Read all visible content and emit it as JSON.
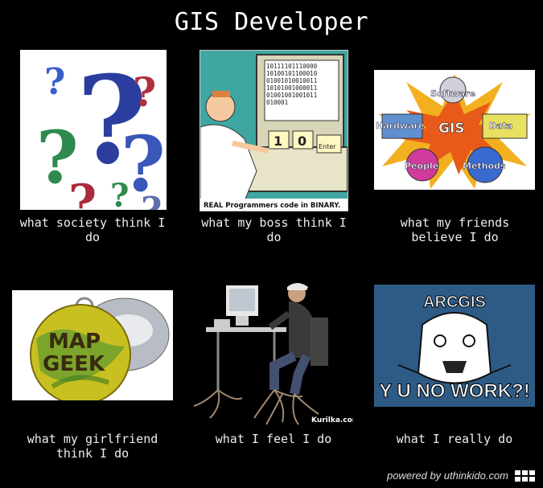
{
  "title": "GIS Developer",
  "panels": [
    {
      "caption": "what society think I do",
      "image": "question-marks"
    },
    {
      "caption": "what my boss think I do",
      "image": "binary-programmer-cartoon",
      "image_text": {
        "binary_lines": [
          "10111101110000",
          "10100101100010",
          "01001010010011",
          "10101001000011",
          "01001001001011",
          "010001"
        ],
        "keys": [
          "1",
          "0",
          "Enter"
        ],
        "footer": "REAL Programmers code in BINARY."
      }
    },
    {
      "caption": "what my friends believe I do",
      "image": "gis-diagram",
      "image_text": {
        "center": "GIS",
        "nodes": [
          "Software",
          "Hardware",
          "Data",
          "People",
          "Methods"
        ]
      }
    },
    {
      "caption": "what my girlfriend think I do",
      "image": "map-geek-button",
      "image_text": {
        "badge": [
          "MAP",
          "GEEK"
        ]
      }
    },
    {
      "caption": "what I feel I do",
      "image": "rooted-programmer",
      "image_text": {
        "credit": "Kurilka.com"
      }
    },
    {
      "caption": "what I really do",
      "image": "y-u-no-meme",
      "image_text": {
        "top": "ARCGIS",
        "bottom": "Y U NO WORK?!"
      }
    }
  ],
  "footer": {
    "text": "powered by uthinkido.com"
  },
  "colors": {
    "background": "#000000",
    "meme_blue": "#2e5a86"
  }
}
